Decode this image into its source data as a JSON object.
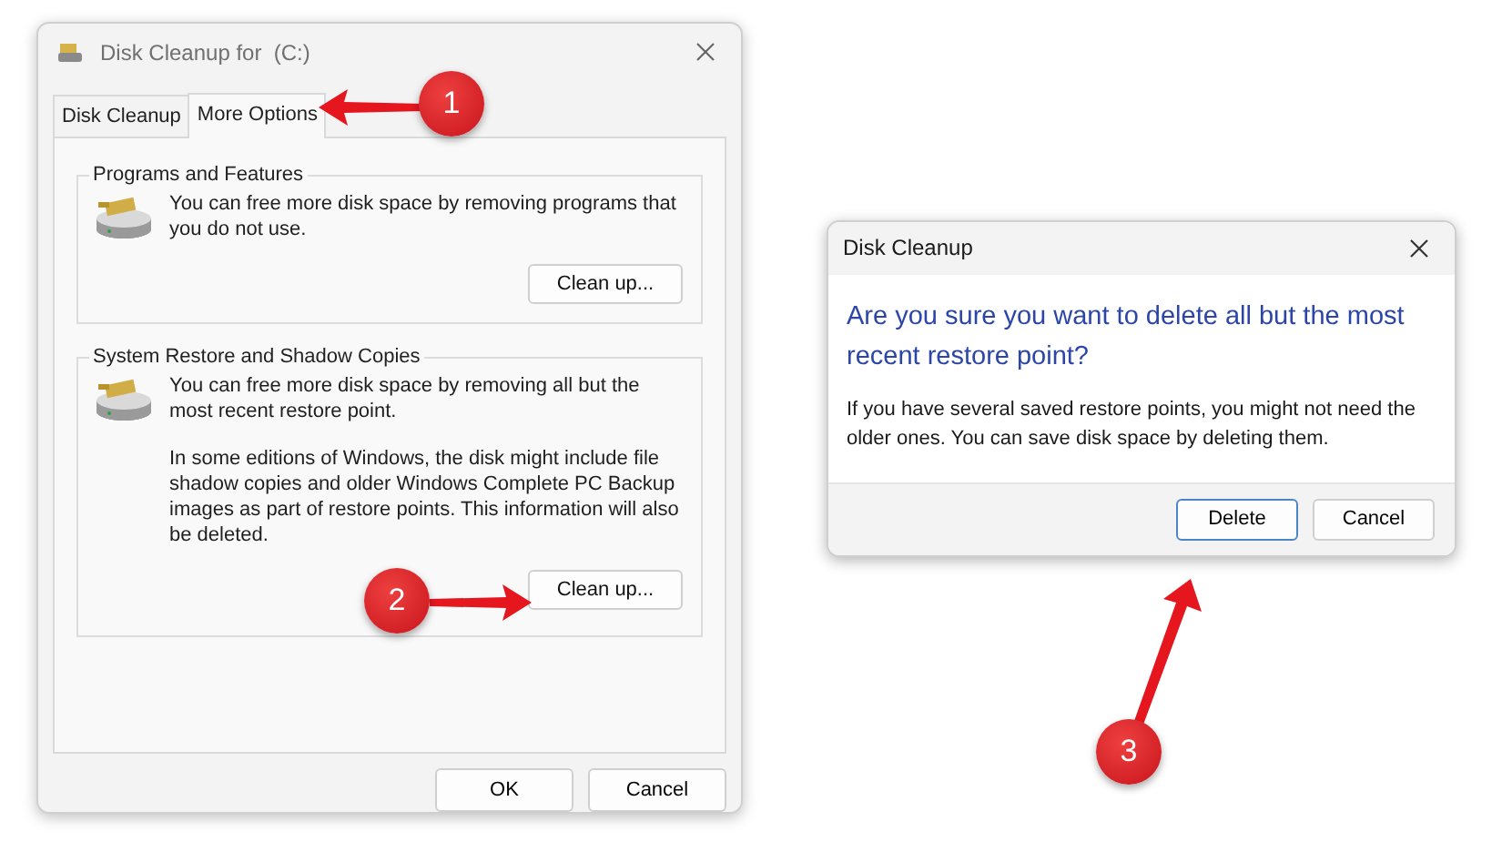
{
  "main_window": {
    "title": "Disk Cleanup for  (C:)",
    "tabs": [
      {
        "label": "Disk Cleanup",
        "selected": false
      },
      {
        "label": "More Options",
        "selected": true
      }
    ],
    "groups": [
      {
        "title": "Programs and Features",
        "paragraphs": [
          "You can free more disk space by removing programs that you do not use."
        ],
        "button": "Clean up..."
      },
      {
        "title": "System Restore and Shadow Copies",
        "paragraphs": [
          "You can free more disk space by removing all but the most recent restore point.",
          "In some editions of Windows, the disk might include file shadow copies and older Windows Complete PC Backup images as part of restore points. This information will also be deleted."
        ],
        "button": "Clean up..."
      }
    ],
    "buttons": [
      "OK",
      "Cancel"
    ]
  },
  "confirm_dialog": {
    "title": "Disk Cleanup",
    "heading": "Are you sure you want to delete all but the most recent restore point?",
    "message": "If you have several saved restore points, you might not need the older ones. You can save disk space by deleting them.",
    "buttons": [
      {
        "label": "Delete",
        "default": true
      },
      {
        "label": "Cancel",
        "default": false
      }
    ]
  },
  "annotations": [
    {
      "number": "1"
    },
    {
      "number": "2"
    },
    {
      "number": "3"
    }
  ]
}
